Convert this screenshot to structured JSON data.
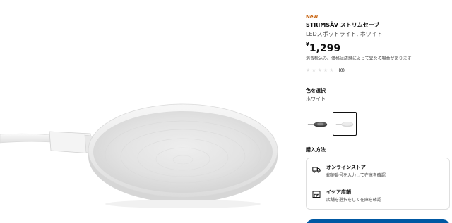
{
  "product": {
    "badge": "New",
    "name": "STRIMSÄV ストリムセーブ",
    "description": "LEDスポットライト, ホワイト",
    "price_currency": "¥",
    "price_amount": "1,299",
    "price_note": "消費税込み。価格は店舗によって異なる場合があります",
    "rating_stars": 0,
    "rating_max": 5,
    "review_count": "(0)"
  },
  "color": {
    "label": "色を選択",
    "selected_value": "ホワイト",
    "swatches": [
      {
        "name": "black",
        "selected": false
      },
      {
        "name": "white",
        "selected": true
      }
    ]
  },
  "purchase": {
    "label": "購入方法",
    "options": [
      {
        "icon": "delivery-truck-icon",
        "title": "オンラインストア",
        "subtitle": "郵便番号を入力して在庫を確認"
      },
      {
        "icon": "store-icon",
        "title": "イケア店舗",
        "subtitle": "店舗を選択をして在庫を確認"
      }
    ]
  },
  "colors": {
    "badge_new": "#c55a00",
    "text_primary": "#111111",
    "text_secondary": "#484848",
    "border": "#dfdfdf",
    "primary_button": "#0058a3"
  }
}
